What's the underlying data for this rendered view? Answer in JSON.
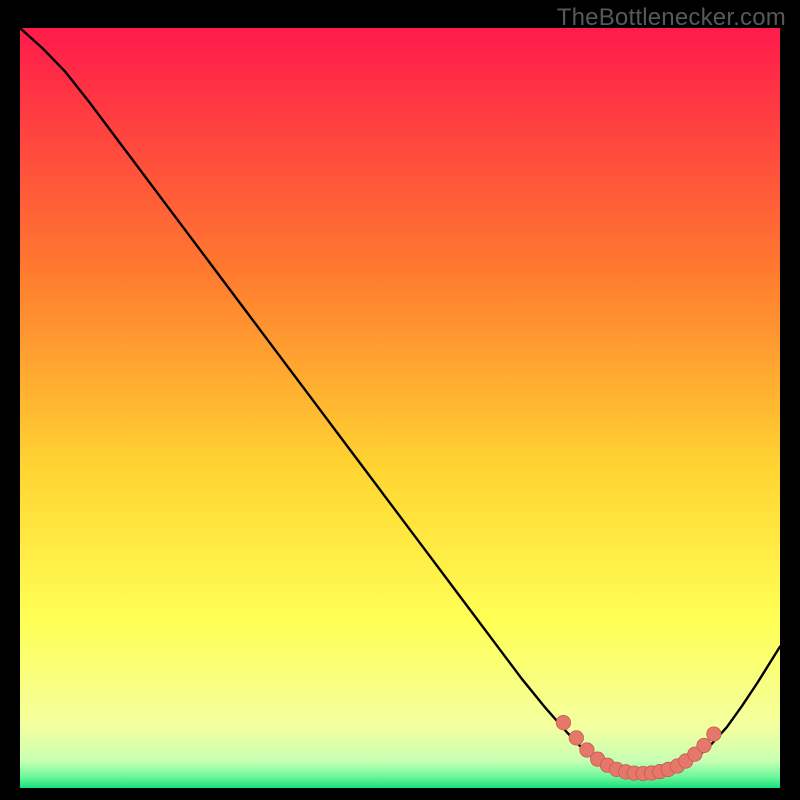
{
  "watermark": "TheBottlenecker.com",
  "colors": {
    "gradient_top": "#ff1a4b",
    "gradient_mid_upper": "#ff7a2f",
    "gradient_mid": "#ffd531",
    "gradient_mid_lower": "#ffff55",
    "gradient_lower": "#f3ffa0",
    "gradient_bottom": "#17e07d",
    "curve": "#000000",
    "marker_fill": "#e5786b",
    "marker_stroke": "#c95a4d",
    "frame": "#000000"
  },
  "chart_data": {
    "type": "line",
    "title": "",
    "xlabel": "",
    "ylabel": "",
    "xlim": [
      0,
      100
    ],
    "ylim": [
      0,
      100
    ],
    "grid": false,
    "legend": false,
    "series": [
      {
        "name": "curve",
        "x": [
          0,
          3,
          6,
          9,
          12,
          15,
          18,
          21,
          24,
          27,
          30,
          33,
          36,
          39,
          42,
          45,
          48,
          51,
          54,
          57,
          60,
          63,
          66,
          69,
          72,
          74,
          75.8,
          77.5,
          79,
          80.5,
          82,
          83.5,
          85,
          86.5,
          88,
          89.5,
          91,
          93,
          95,
          97,
          100
        ],
        "y": [
          100,
          97.3,
          94.2,
          90.4,
          86.4,
          82.4,
          78.4,
          74.4,
          70.4,
          66.4,
          62.4,
          58.4,
          54.4,
          50.4,
          46.4,
          42.4,
          38.4,
          34.4,
          30.4,
          26.4,
          22.4,
          18.4,
          14.4,
          10.7,
          7.3,
          5.2,
          3.9,
          3.0,
          2.4,
          2.05,
          1.9,
          2.0,
          2.25,
          2.7,
          3.4,
          4.4,
          5.8,
          8.0,
          10.8,
          13.8,
          18.6
        ]
      }
    ],
    "markers": {
      "name": "highlight-points",
      "x": [
        71.5,
        73.2,
        74.6,
        76.0,
        77.3,
        78.5,
        79.7,
        80.8,
        82.0,
        83.1,
        84.2,
        85.3,
        86.5,
        87.6,
        88.8,
        90.0,
        91.3
      ],
      "y": [
        8.6,
        6.6,
        5.0,
        3.8,
        3.0,
        2.45,
        2.12,
        1.95,
        1.9,
        1.97,
        2.15,
        2.45,
        2.9,
        3.55,
        4.45,
        5.6,
        7.1
      ]
    }
  }
}
